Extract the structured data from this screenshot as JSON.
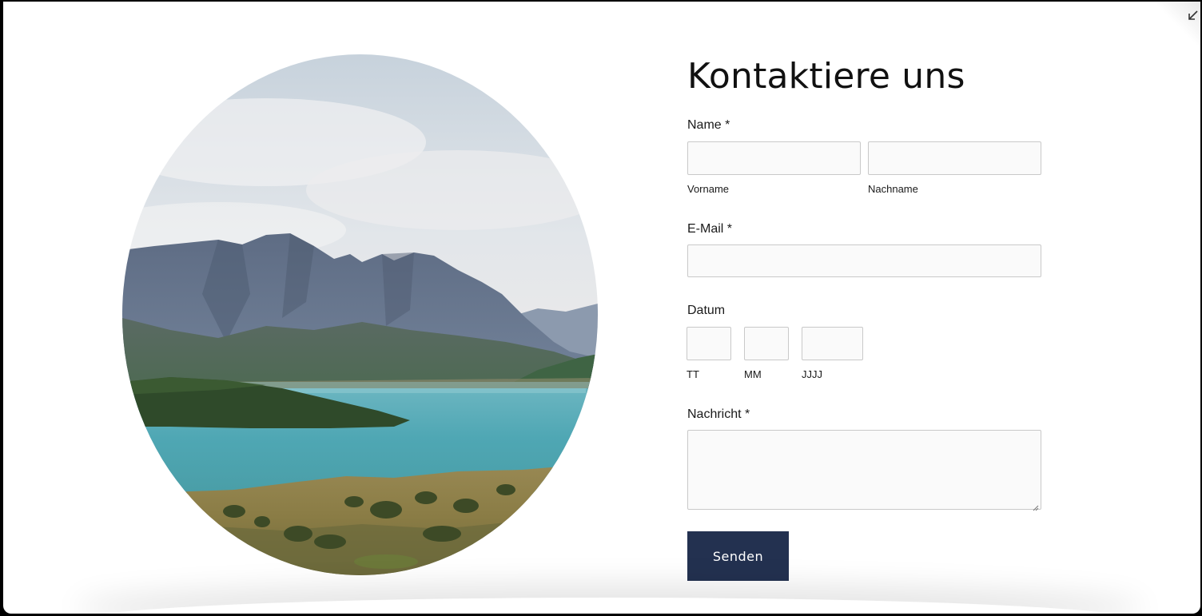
{
  "contact": {
    "title": "Kontaktiere uns",
    "name_label": "Name *",
    "firstname_sublabel": "Vorname",
    "firstname_value": "",
    "lastname_sublabel": "Nachname",
    "lastname_value": "",
    "email_label": "E-Mail *",
    "email_value": "",
    "date_label": "Datum",
    "date_day_sublabel": "TT",
    "date_month_sublabel": "MM",
    "date_year_sublabel": "JJJJ",
    "message_label": "Nachricht *",
    "message_value": "",
    "submit_label": "Senden"
  },
  "icons": {
    "corner": "collapse-arrow-icon",
    "textarea": "resize-handle-icon"
  },
  "colors": {
    "button_bg": "#233150",
    "button_text": "#ffffff",
    "input_bg": "#fafafa",
    "input_border": "#c9c9c9"
  }
}
